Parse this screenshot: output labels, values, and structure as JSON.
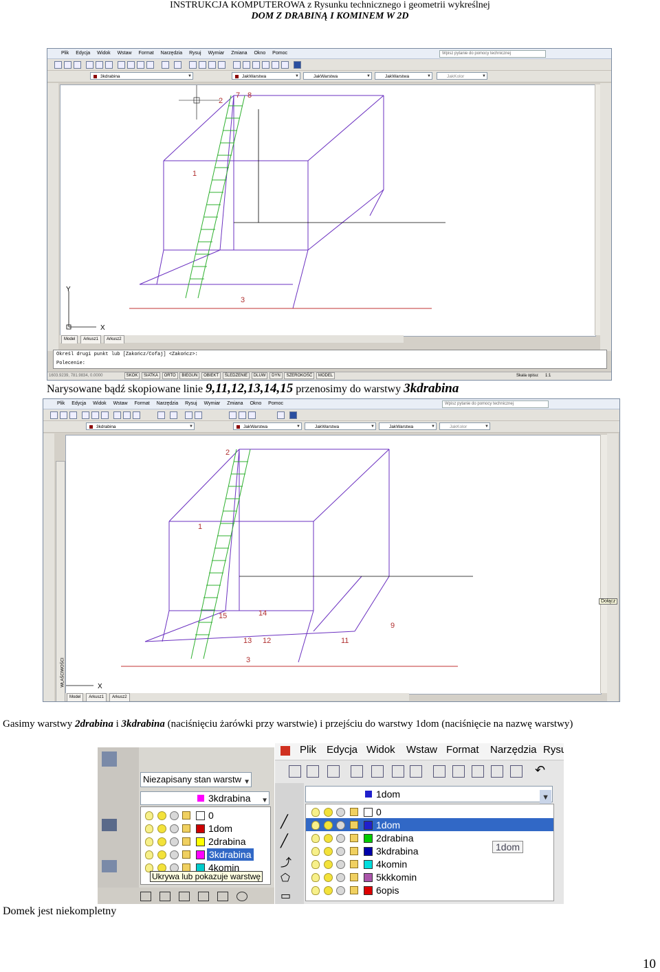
{
  "header": {
    "line1": "INSTRUKCJA KOMPUTEROWA  z Rysunku technicznego i geometrii wykreślnej",
    "line2": "DOM Z DRABINĄ I KOMINEM W 2D"
  },
  "cad_menu": [
    "Plik",
    "Edycja",
    "Widok",
    "Wstaw",
    "Format",
    "Narzędzia",
    "Rysuj",
    "Wymiar",
    "Zmiana",
    "Okno",
    "Pomoc"
  ],
  "cad1": {
    "help_placeholder": "Wpisz pytanie do pomocy technicznej",
    "layer_combo": "3kdrabina",
    "color_combo": "JakWarstwa",
    "linetype_combo": "JakWarstwa",
    "lineweight_combo": "JakWarstwa",
    "plotstyle_combo": "JakKolor",
    "labels": {
      "l1": "1",
      "l2": "2",
      "l3": "3",
      "l7": "7",
      "l8": "8",
      "axis_y": "Y",
      "axis_x": "X"
    },
    "tabs": [
      "Model",
      "Arkusz1",
      "Arkusz2"
    ],
    "command_line1": "Określ drugi punkt lub [Zakończ/Cofaj] <Zakończ>:",
    "command_line2": "Polecenie:",
    "coords": "1603.9239, 781.9834, 0.0000",
    "status_buttons": [
      "SKOK",
      "SIATKA",
      "ORTO",
      "BIEGUN",
      "OBIEKT",
      "ŚLEDZENIE",
      "DLUW",
      "DYN",
      "SZEROKOŚĆ",
      "MODEL"
    ],
    "scale_label": "Skala opisu:",
    "scale_value": "1:1"
  },
  "caption1": {
    "before": "Narysowane bądź skopiowane linie ",
    "lines": "9,11,12,13,14,15",
    "middle": " przenosimy do warstwy ",
    "layer": "3kdrabina"
  },
  "cad2": {
    "help_placeholder": "Wpisz pytanie do pomocy technicznej",
    "layer_combo": "3kdrabina",
    "color_combo": "JakWarstwa",
    "linetype_combo": "JakWarstwa",
    "lineweight_combo": "JakWarstwa",
    "plotstyle_combo": "JakKolor",
    "labels": {
      "l1": "1",
      "l2": "2",
      "l3": "3",
      "l9": "9",
      "l11": "11",
      "l12": "12",
      "l13": "13",
      "l14": "14",
      "l15": "15",
      "axis_x": "X"
    },
    "tabs": [
      "Model",
      "Arkusz1",
      "Arkusz2"
    ],
    "side_label": "WŁAŚCIWOŚCI",
    "tooltip": "Dołącz"
  },
  "caption2": {
    "t1": "Gasimy warstwy ",
    "b1": "2drabina",
    "t2": " i ",
    "b2": "3kdrabina",
    "t3": " (naciśnięciu żarówki przy warstwie) i przejściu do warstwy 1dom (naciśnięcie na nazwę warstwy)"
  },
  "layers_left": {
    "state_combo": "Niezapisany stan warstw",
    "current": "3kdrabina",
    "items": [
      {
        "name": "0",
        "color": "#ffffff"
      },
      {
        "name": "1dom",
        "color": "#cc0000"
      },
      {
        "name": "2drabina",
        "color": "#ffff00"
      },
      {
        "name": "3kdrabina",
        "color": "#ff00ff"
      },
      {
        "name": "4komin",
        "color": "#00cccc"
      }
    ],
    "tooltip": "Ukrywa lub pokazuje warstwę"
  },
  "layers_right": {
    "menu": [
      "Plik",
      "Edycja",
      "Widok",
      "Wstaw",
      "Format",
      "Narzędzia",
      "Rysu"
    ],
    "current": "1dom",
    "items": [
      {
        "name": "0",
        "color": "#ffffff"
      },
      {
        "name": "1dom",
        "color": "#2020cc"
      },
      {
        "name": "2drabina",
        "color": "#00cc00"
      },
      {
        "name": "3kdrabina",
        "color": "#0000aa"
      },
      {
        "name": "4komin",
        "color": "#00dddd"
      },
      {
        "name": "5kkkomin",
        "color": "#aa55aa"
      },
      {
        "name": "6opis",
        "color": "#dd0000"
      }
    ],
    "tooltip": "1dom"
  },
  "footer_text": "Domek jest niekompletny",
  "page_number": "10"
}
